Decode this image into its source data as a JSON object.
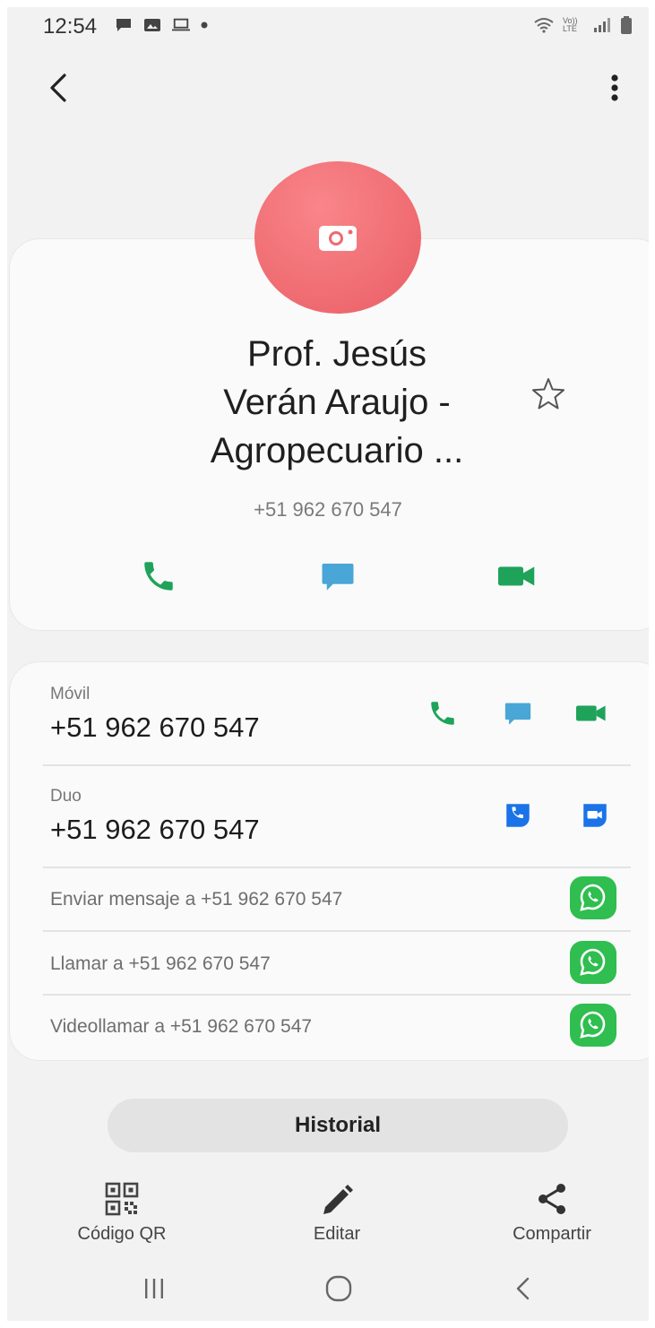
{
  "status_bar": {
    "time": "12:54",
    "left_icons": [
      "chat-icon",
      "image-icon",
      "laptop-icon",
      "dot-icon"
    ],
    "right_icons": [
      "wifi-icon",
      "volte-icon",
      "signal-icon",
      "battery-icon"
    ],
    "volte_text": "Vo)) LTE"
  },
  "contact": {
    "name_lines": [
      "Prof. Jesús",
      "Verán Araujo -",
      "Agropecuario ..."
    ],
    "phone": "+51 962 670 547",
    "avatar_color": "#ee6a70"
  },
  "details": {
    "mobile": {
      "label": "Móvil",
      "value": "+51 962 670 547"
    },
    "duo": {
      "label": "Duo",
      "value": "+51 962 670 547"
    },
    "whatsapp": [
      {
        "text": "Enviar mensaje a +51 962 670 547"
      },
      {
        "text": "Llamar a +51 962 670 547"
      },
      {
        "text": "Videollamar a +51 962 670 547"
      }
    ]
  },
  "historial_label": "Historial",
  "bottom_actions": [
    {
      "label": "Código QR",
      "icon": "qr-code-icon"
    },
    {
      "label": "Editar",
      "icon": "pencil-icon"
    },
    {
      "label": "Compartir",
      "icon": "share-icon"
    }
  ],
  "colors": {
    "call_green": "#1fa35a",
    "message_blue": "#4aa6d6",
    "duo_blue": "#1a73e8",
    "whatsapp_green": "#2fbe4f"
  }
}
